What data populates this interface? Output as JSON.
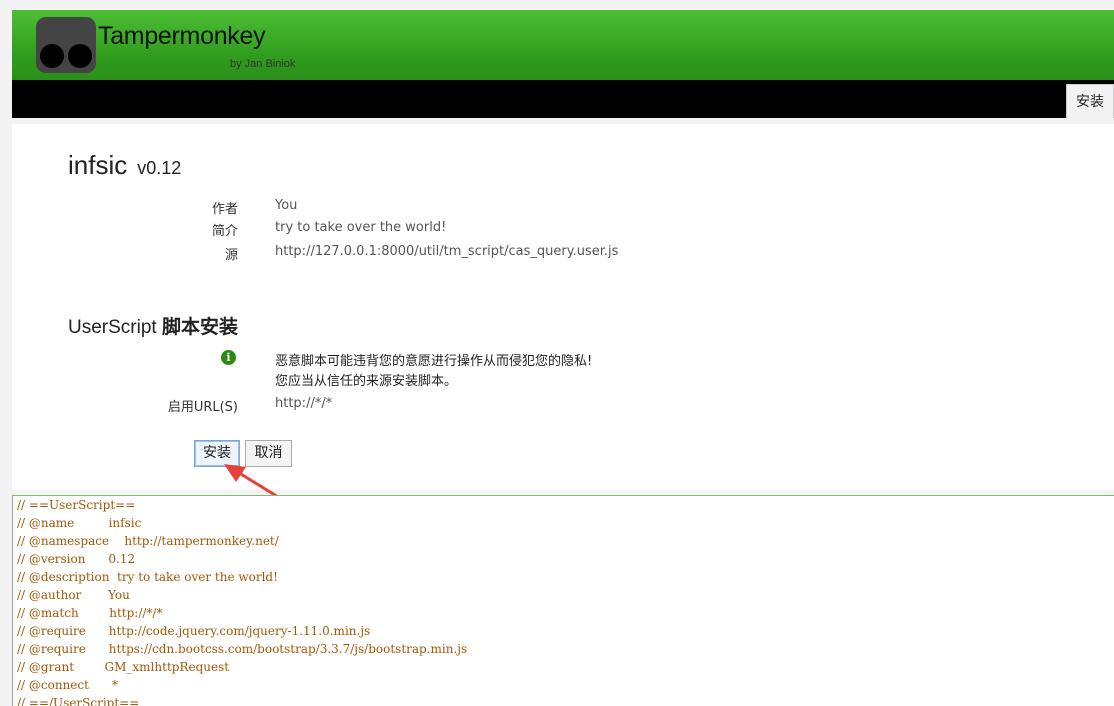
{
  "header": {
    "brand": "Tampermonkey",
    "byline": "by Jan Biniok",
    "install_tab": "安装"
  },
  "script": {
    "name": "infsic",
    "version": "v0.12",
    "meta": [
      {
        "label": "作者",
        "value": "You"
      },
      {
        "label": "简介",
        "value": "try to take over the world!"
      },
      {
        "label": "源",
        "value": "http://127.0.0.1:8000/util/tm_script/cas_query.user.js"
      }
    ]
  },
  "install_section": {
    "title_prefix": "UserScript",
    "title_bold": "脚本安装",
    "warning_line1": "恶意脚本可能违背您的意愿进行操作从而侵犯您的隐私!",
    "warning_line2": "您应当从信任的来源安装脚本。",
    "url_label": "启用URL(S)",
    "url_value": "http://*/*",
    "install_button": "安装",
    "cancel_button": "取消",
    "info_icon": "info-icon"
  },
  "code_lines": [
    "// ==UserScript==",
    "// @name         infsic",
    "// @namespace    http://tampermonkey.net/",
    "// @version      0.12",
    "// @description  try to take over the world!",
    "// @author       You",
    "// @match        http://*/*",
    "// @require      http://code.jquery.com/jquery-1.11.0.min.js",
    "// @require      https://cdn.bootcss.com/bootstrap/3.3.7/js/bootstrap.min.js",
    "// @grant        GM_xmlhttpRequest",
    "// @connect      *",
    "// ==/UserScript=="
  ],
  "colors": {
    "header_green": "#3aab27",
    "arrow_red": "#e8403a",
    "code_text": "#a25808"
  }
}
